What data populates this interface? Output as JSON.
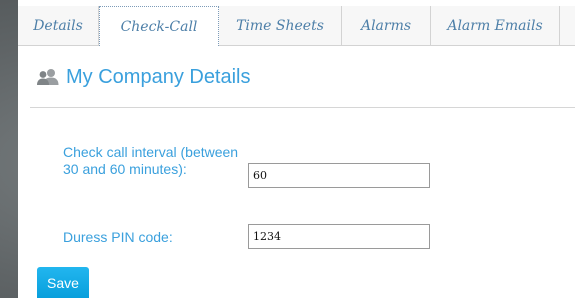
{
  "tabs": [
    {
      "label": "Details",
      "active": false
    },
    {
      "label": "Check-Call",
      "active": true
    },
    {
      "label": "Time Sheets",
      "active": false
    },
    {
      "label": "Alarms",
      "active": false
    },
    {
      "label": "Alarm Emails",
      "active": false
    }
  ],
  "header": {
    "icon": "users-icon",
    "title": "My Company Details"
  },
  "form": {
    "interval_label": "Check call interval (between 30 and 60 minutes):",
    "interval_value": "60",
    "pin_label": "Duress PIN code:",
    "pin_value": "1234"
  },
  "actions": {
    "save_label": "Save"
  },
  "colors": {
    "accent": "#3aa0dd",
    "tab_text": "#4d7fa8",
    "button": "#14abe6",
    "backdrop": "#5f6466"
  }
}
